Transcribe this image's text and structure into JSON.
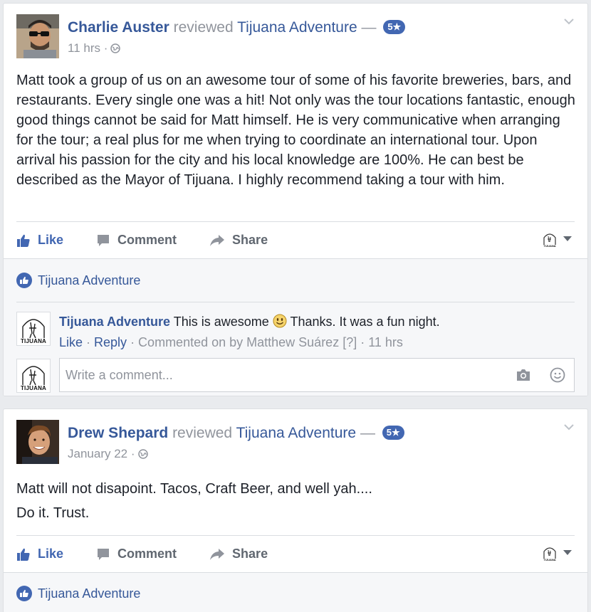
{
  "posts": [
    {
      "author": "Charlie Auster",
      "action": "reviewed",
      "page": "Tijuana Adventure",
      "dash": "—",
      "rating": "5★",
      "time": "11 hrs ·",
      "paragraphs": [
        "Matt took a group of us on an awesome tour of some of his favorite breweries, bars, and restaurants. Every single one was a hit! Not only was the tour locations fantastic, enough good things cannot be said for Matt himself. He is very communicative when arranging for the tour; a real plus for me when trying to coordinate an international tour. Upon arrival his passion for the city and his local knowledge are 100%. He can best be described as the Mayor of Tijuana. I highly recommend taking a tour with him."
      ],
      "actions": {
        "like": "Like",
        "comment": "Comment",
        "share": "Share"
      },
      "liked_by": "Tijuana Adventure",
      "comment": {
        "author": "Tijuana Adventure",
        "text_before": "This is awesome",
        "text_after": "Thanks. It was a fun night.",
        "meta_like": "Like",
        "meta_sep1": " · ",
        "meta_reply": "Reply",
        "meta_rest": " · Commented on by Matthew Suárez [?] · 11 hrs"
      },
      "write_placeholder": "Write a comment..."
    },
    {
      "author": "Drew Shepard",
      "action": "reviewed",
      "page": "Tijuana Adventure",
      "dash": "—",
      "rating": "5★",
      "time": "January 22 ·",
      "paragraphs": [
        "Matt will not disapoint. Tacos, Craft Beer, and well yah....",
        "Do it. Trust."
      ],
      "actions": {
        "like": "Like",
        "comment": "Comment",
        "share": "Share"
      },
      "liked_by": "Tijuana Adventure"
    }
  ],
  "logo_text": "TIJUANA",
  "colors": {
    "link": "#365899",
    "accent": "#4267b2",
    "muted": "#90949c",
    "gray_bg": "#f6f7f9"
  }
}
